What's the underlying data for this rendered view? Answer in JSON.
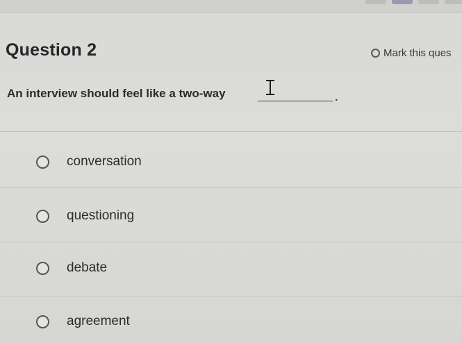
{
  "question": {
    "title": "Question 2",
    "mark_label": "Mark this ques",
    "prompt": "An interview should feel like a two-way",
    "blank_suffix": "."
  },
  "answers": [
    {
      "label": "conversation"
    },
    {
      "label": "questioning"
    },
    {
      "label": "debate"
    },
    {
      "label": "agreement"
    }
  ],
  "colors": {
    "background": "#d9d9d7",
    "text": "#2a2a2a",
    "radio_border": "#555555"
  },
  "icons": {
    "cursor": "text-cursor-icon"
  }
}
